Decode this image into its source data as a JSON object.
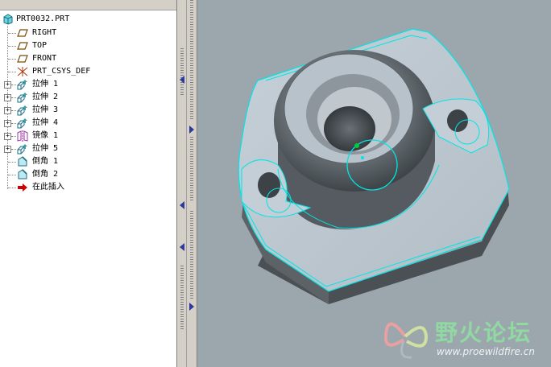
{
  "model_tree": {
    "root": {
      "label": "PRT0032.PRT",
      "icon": "part-icon"
    },
    "items": [
      {
        "label": "RIGHT",
        "icon": "datum-plane-icon",
        "expandable": false
      },
      {
        "label": "TOP",
        "icon": "datum-plane-icon",
        "expandable": false
      },
      {
        "label": "FRONT",
        "icon": "datum-plane-icon",
        "expandable": false
      },
      {
        "label": "PRT_CSYS_DEF",
        "icon": "csys-icon",
        "expandable": false
      },
      {
        "label": "拉伸 1",
        "icon": "extrude-icon",
        "expandable": true
      },
      {
        "label": "拉伸 2",
        "icon": "extrude-icon",
        "expandable": true
      },
      {
        "label": "拉伸 3",
        "icon": "extrude-icon",
        "expandable": true
      },
      {
        "label": "拉伸 4",
        "icon": "extrude-icon",
        "expandable": true
      },
      {
        "label": "镜像 1",
        "icon": "mirror-icon",
        "expandable": true
      },
      {
        "label": "拉伸 5",
        "icon": "extrude-icon",
        "expandable": true
      },
      {
        "label": "倒角 1",
        "icon": "chamfer-icon",
        "expandable": false
      },
      {
        "label": "倒角 2",
        "icon": "chamfer-icon",
        "expandable": false
      },
      {
        "label": "在此插入",
        "icon": "insert-here-arrow-icon",
        "expandable": false
      }
    ]
  },
  "viewport": {
    "background_color": "#9ba6ad",
    "highlight_color": "#00e5e5",
    "model": "part-model"
  },
  "watermark": {
    "text": "野火论坛",
    "url": "www.proewildfire.cn"
  }
}
